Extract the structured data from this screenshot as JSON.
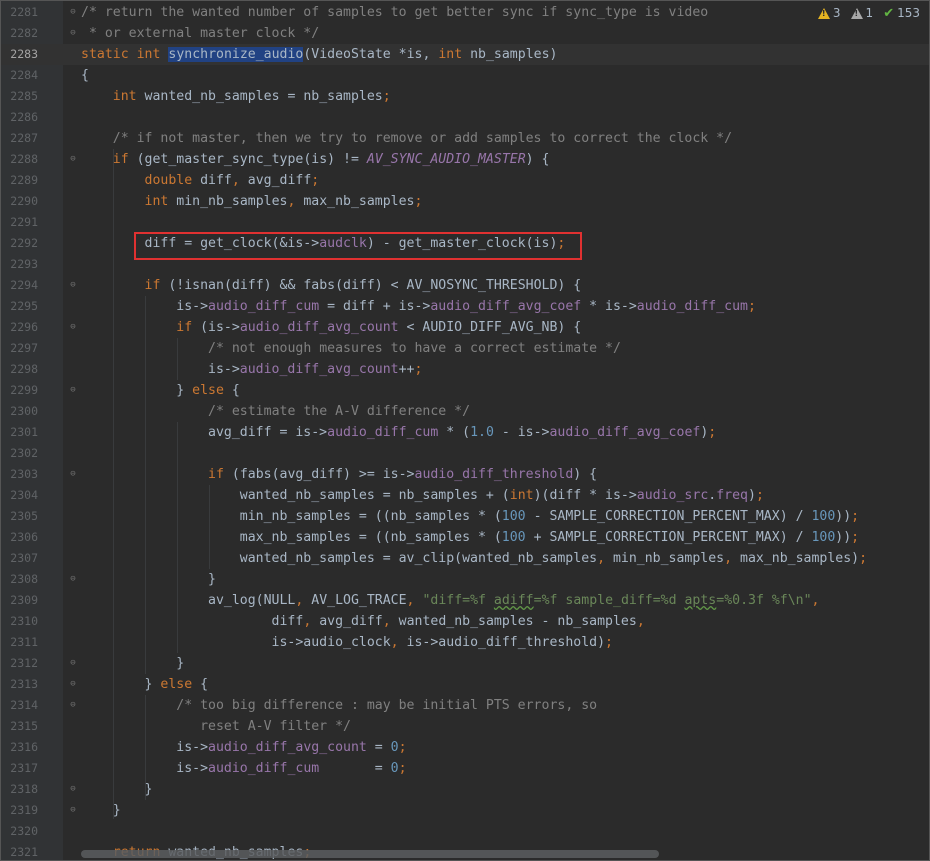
{
  "inspection": {
    "warnings": "3",
    "weak_warnings": "1",
    "typos": "153"
  },
  "lines": [
    {
      "num": "2281",
      "fold": "⊖",
      "tokens": [
        [
          "/* return the wanted number of samples to get better sync if sync_type is video",
          "cm"
        ]
      ]
    },
    {
      "num": "2282",
      "fold": "⊖",
      "tokens": [
        [
          " * or external master clock */",
          "cm"
        ]
      ]
    },
    {
      "num": "2283",
      "fold": "",
      "current": true,
      "tokens": [
        [
          "static",
          "kw"
        ],
        [
          " ",
          ""
        ],
        [
          "int",
          "kw"
        ],
        [
          " ",
          ""
        ],
        [
          "synchronize_audio",
          "sel"
        ],
        [
          "(VideoState *is, ",
          ""
        ],
        [
          "int",
          "kw"
        ],
        [
          " nb_samples)",
          ""
        ]
      ]
    },
    {
      "num": "2284",
      "fold": "",
      "tokens": [
        [
          "{",
          ""
        ]
      ]
    },
    {
      "num": "2285",
      "fold": "",
      "tokens": [
        [
          "    ",
          ""
        ],
        [
          "int",
          "kw"
        ],
        [
          " wanted_nb_samples = nb_samples",
          ""
        ],
        [
          ";",
          "kw"
        ]
      ]
    },
    {
      "num": "2286",
      "fold": "",
      "tokens": []
    },
    {
      "num": "2287",
      "fold": "",
      "tokens": [
        [
          "    ",
          ""
        ],
        [
          "/* if not master, then we try to remove or add samples to correct the clock */",
          "cm"
        ]
      ]
    },
    {
      "num": "2288",
      "fold": "⊖",
      "tokens": [
        [
          "    ",
          ""
        ],
        [
          "if",
          "kw"
        ],
        [
          " (get_master_sync_type(is) != ",
          ""
        ],
        [
          "AV_SYNC_AUDIO_MASTER",
          "cst"
        ],
        [
          ") {",
          ""
        ]
      ]
    },
    {
      "num": "2289",
      "fold": "",
      "tokens": [
        [
          "        ",
          ""
        ],
        [
          "double",
          "kw"
        ],
        [
          " diff",
          ""
        ],
        [
          ",",
          "kw"
        ],
        [
          " avg_diff",
          ""
        ],
        [
          ";",
          "kw"
        ]
      ]
    },
    {
      "num": "2290",
      "fold": "",
      "tokens": [
        [
          "        ",
          ""
        ],
        [
          "int",
          "kw"
        ],
        [
          " min_nb_samples",
          ""
        ],
        [
          ",",
          "kw"
        ],
        [
          " max_nb_samples",
          ""
        ],
        [
          ";",
          "kw"
        ]
      ]
    },
    {
      "num": "2291",
      "fold": "",
      "tokens": []
    },
    {
      "num": "2292",
      "fold": "",
      "tokens": [
        [
          "        diff = get_clock(&is->",
          ""
        ],
        [
          "audclk",
          "fld"
        ],
        [
          ") - get_master_clock(is)",
          ""
        ],
        [
          ";",
          "kw"
        ]
      ]
    },
    {
      "num": "2293",
      "fold": "",
      "tokens": []
    },
    {
      "num": "2294",
      "fold": "⊖",
      "tokens": [
        [
          "        ",
          ""
        ],
        [
          "if",
          "kw"
        ],
        [
          " (!isnan(diff) && fabs(diff) < AV_NOSYNC_THRESHOLD) {",
          ""
        ]
      ]
    },
    {
      "num": "2295",
      "fold": "",
      "tokens": [
        [
          "            is->",
          ""
        ],
        [
          "audio_diff_cum",
          "fld"
        ],
        [
          " = diff + is->",
          ""
        ],
        [
          "audio_diff_avg_coef",
          "fld"
        ],
        [
          " * is->",
          ""
        ],
        [
          "audio_diff_cum",
          "fld"
        ],
        [
          ";",
          "kw"
        ]
      ]
    },
    {
      "num": "2296",
      "fold": "⊖",
      "tokens": [
        [
          "            ",
          ""
        ],
        [
          "if",
          "kw"
        ],
        [
          " (is->",
          ""
        ],
        [
          "audio_diff_avg_count",
          "fld"
        ],
        [
          " < AUDIO_DIFF_AVG_NB) {",
          ""
        ]
      ]
    },
    {
      "num": "2297",
      "fold": "",
      "tokens": [
        [
          "                ",
          ""
        ],
        [
          "/* not enough measures to have a correct estimate */",
          "cm"
        ]
      ]
    },
    {
      "num": "2298",
      "fold": "",
      "tokens": [
        [
          "                is->",
          ""
        ],
        [
          "audio_diff_avg_count",
          "fld"
        ],
        [
          "++",
          ""
        ],
        [
          ";",
          "kw"
        ]
      ]
    },
    {
      "num": "2299",
      "fold": "⊖",
      "tokens": [
        [
          "            } ",
          ""
        ],
        [
          "else",
          "kw"
        ],
        [
          " {",
          ""
        ]
      ]
    },
    {
      "num": "2300",
      "fold": "",
      "tokens": [
        [
          "                ",
          ""
        ],
        [
          "/* estimate the A-V difference */",
          "cm"
        ]
      ]
    },
    {
      "num": "2301",
      "fold": "",
      "tokens": [
        [
          "                avg_diff = is->",
          ""
        ],
        [
          "audio_diff_cum",
          "fld"
        ],
        [
          " * (",
          ""
        ],
        [
          "1.0",
          "num"
        ],
        [
          " - is->",
          ""
        ],
        [
          "audio_diff_avg_coef",
          "fld"
        ],
        [
          ")",
          ""
        ],
        [
          ";",
          "kw"
        ]
      ]
    },
    {
      "num": "2302",
      "fold": "",
      "tokens": []
    },
    {
      "num": "2303",
      "fold": "⊖",
      "tokens": [
        [
          "                ",
          ""
        ],
        [
          "if",
          "kw"
        ],
        [
          " (fabs(avg_diff) >= is->",
          ""
        ],
        [
          "audio_diff_threshold",
          "fld"
        ],
        [
          ") {",
          ""
        ]
      ]
    },
    {
      "num": "2304",
      "fold": "",
      "tokens": [
        [
          "                    wanted_nb_samples = nb_samples + (",
          ""
        ],
        [
          "int",
          "kw"
        ],
        [
          ")(diff * is->",
          ""
        ],
        [
          "audio_src",
          "fld"
        ],
        [
          ".",
          ""
        ],
        [
          "freq",
          "fld"
        ],
        [
          ")",
          ""
        ],
        [
          ";",
          "kw"
        ]
      ]
    },
    {
      "num": "2305",
      "fold": "",
      "tokens": [
        [
          "                    min_nb_samples = ((nb_samples * (",
          ""
        ],
        [
          "100",
          "num"
        ],
        [
          " - SAMPLE_CORRECTION_PERCENT_MAX) / ",
          ""
        ],
        [
          "100",
          "num"
        ],
        [
          "))",
          ""
        ],
        [
          ";",
          "kw"
        ]
      ]
    },
    {
      "num": "2306",
      "fold": "",
      "tokens": [
        [
          "                    max_nb_samples = ((nb_samples * (",
          ""
        ],
        [
          "100",
          "num"
        ],
        [
          " + SAMPLE_CORRECTION_PERCENT_MAX) / ",
          ""
        ],
        [
          "100",
          "num"
        ],
        [
          "))",
          ""
        ],
        [
          ";",
          "kw"
        ]
      ]
    },
    {
      "num": "2307",
      "fold": "",
      "tokens": [
        [
          "                    wanted_nb_samples = av_clip(wanted_nb_samples",
          ""
        ],
        [
          ",",
          "kw"
        ],
        [
          " min_nb_samples",
          ""
        ],
        [
          ",",
          "kw"
        ],
        [
          " max_nb_samples)",
          ""
        ],
        [
          ";",
          "kw"
        ]
      ]
    },
    {
      "num": "2308",
      "fold": "⊖",
      "tokens": [
        [
          "                }",
          ""
        ]
      ]
    },
    {
      "num": "2309",
      "fold": "",
      "tokens": [
        [
          "                av_log(NULL",
          ""
        ],
        [
          ",",
          "kw"
        ],
        [
          " AV_LOG_TRACE",
          ""
        ],
        [
          ",",
          "kw"
        ],
        [
          " ",
          ""
        ],
        [
          "\"diff=%f ",
          "str"
        ],
        [
          "adiff",
          "typo"
        ],
        [
          "=%f sample_diff=%d ",
          "str"
        ],
        [
          "apts",
          "typo"
        ],
        [
          "=%0.3f %f\\n\"",
          "str"
        ],
        [
          ",",
          "kw"
        ]
      ]
    },
    {
      "num": "2310",
      "fold": "",
      "tokens": [
        [
          "                        diff",
          ""
        ],
        [
          ",",
          "kw"
        ],
        [
          " avg_diff",
          ""
        ],
        [
          ",",
          "kw"
        ],
        [
          " wanted_nb_samples - nb_samples",
          ""
        ],
        [
          ",",
          "kw"
        ]
      ]
    },
    {
      "num": "2311",
      "fold": "",
      "tokens": [
        [
          "                        is->audio_clock",
          ""
        ],
        [
          ",",
          "kw"
        ],
        [
          " is->audio_diff_threshold)",
          ""
        ],
        [
          ";",
          "kw"
        ]
      ]
    },
    {
      "num": "2312",
      "fold": "⊖",
      "tokens": [
        [
          "            }",
          ""
        ]
      ]
    },
    {
      "num": "2313",
      "fold": "⊖",
      "tokens": [
        [
          "        } ",
          ""
        ],
        [
          "else",
          "kw"
        ],
        [
          " {",
          ""
        ]
      ]
    },
    {
      "num": "2314",
      "fold": "⊖",
      "tokens": [
        [
          "            ",
          ""
        ],
        [
          "/* too big difference : may be initial PTS errors, so",
          "cm"
        ]
      ]
    },
    {
      "num": "2315",
      "fold": "",
      "tokens": [
        [
          "               ",
          ""
        ],
        [
          "reset A-V filter */",
          "cm"
        ]
      ]
    },
    {
      "num": "2316",
      "fold": "",
      "tokens": [
        [
          "            is->",
          ""
        ],
        [
          "audio_diff_avg_count",
          "fld"
        ],
        [
          " = ",
          ""
        ],
        [
          "0",
          "num"
        ],
        [
          ";",
          "kw"
        ]
      ]
    },
    {
      "num": "2317",
      "fold": "",
      "tokens": [
        [
          "            is->",
          ""
        ],
        [
          "audio_diff_cum",
          "fld"
        ],
        [
          "       = ",
          ""
        ],
        [
          "0",
          "num"
        ],
        [
          ";",
          "kw"
        ]
      ]
    },
    {
      "num": "2318",
      "fold": "⊖",
      "tokens": [
        [
          "        }",
          ""
        ]
      ]
    },
    {
      "num": "2319",
      "fold": "⊖",
      "tokens": [
        [
          "    }",
          ""
        ]
      ]
    },
    {
      "num": "2320",
      "fold": "",
      "tokens": []
    },
    {
      "num": "2321",
      "fold": "",
      "tokens": [
        [
          "    ",
          ""
        ],
        [
          "return",
          "kw"
        ],
        [
          " wanted_nb_samples",
          ""
        ],
        [
          ";",
          "kw"
        ]
      ]
    }
  ]
}
